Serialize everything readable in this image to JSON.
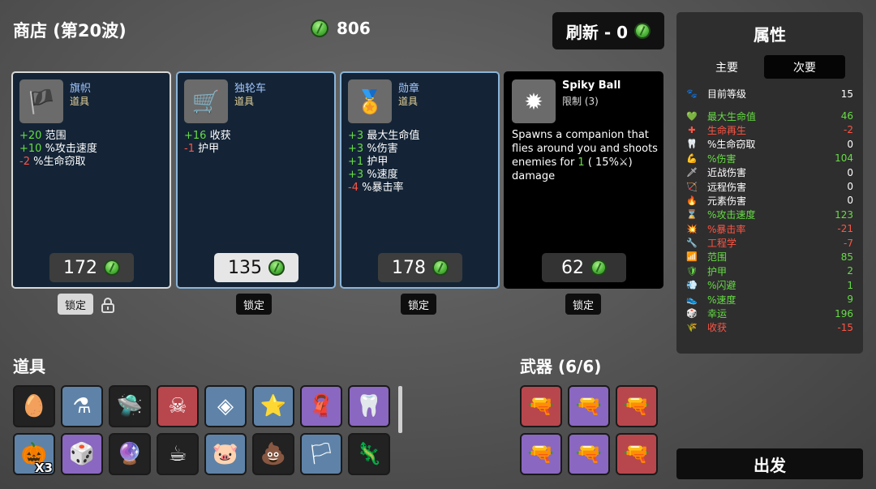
{
  "header": {
    "title": "商店 (第20波)",
    "gold": "806",
    "refresh_label": "刷新 - 0"
  },
  "shop": [
    {
      "name": "旗帜",
      "type": "道具",
      "icon": "flag-icon",
      "glyph": "🏴",
      "stats": [
        {
          "v": "+20",
          "t": "范围",
          "c": "pos"
        },
        {
          "v": "+10",
          "t": "%攻击速度",
          "c": "pos"
        },
        {
          "v": "-2",
          "t": "%生命窃取",
          "c": "neg"
        }
      ],
      "price": "172",
      "lock": "锁定"
    },
    {
      "name": "独轮车",
      "type": "道具",
      "icon": "wheelbarrow-icon",
      "glyph": "🛒",
      "stats": [
        {
          "v": "+16",
          "t": "收获",
          "c": "pos"
        },
        {
          "v": "-1",
          "t": "护甲",
          "c": "neg"
        }
      ],
      "price": "135",
      "lock": "锁定"
    },
    {
      "name": "勋章",
      "type": "道具",
      "icon": "medal-icon",
      "glyph": "🏅",
      "stats": [
        {
          "v": "+3",
          "t": "最大生命值",
          "c": "pos"
        },
        {
          "v": "+3",
          "t": "%伤害",
          "c": "pos"
        },
        {
          "v": "+1",
          "t": "护甲",
          "c": "pos"
        },
        {
          "v": "+3",
          "t": "%速度",
          "c": "pos"
        },
        {
          "v": "-4",
          "t": "%暴击率",
          "c": "neg"
        }
      ],
      "price": "178",
      "lock": "锁定"
    },
    {
      "name": "Spiky Ball",
      "type": "限制 (3)",
      "icon": "spiky-ball-icon",
      "glyph": "✹",
      "desc_a": "Spawns a companion that flies around you and shoots enemies for ",
      "desc_hl": "1",
      "desc_b": " ( 15%⚔) damage",
      "price": "62",
      "lock": "锁定"
    }
  ],
  "stats_panel": {
    "title": "属性",
    "tab_main": "主要",
    "tab_sub": "次要",
    "level": {
      "label": "目前等级",
      "value": "15",
      "icon": "🐾"
    },
    "rows": [
      {
        "label": "最大生命值",
        "value": "46",
        "color": "#66dd44",
        "icon": "💚"
      },
      {
        "label": "生命再生",
        "value": "-2",
        "color": "#ff5544",
        "icon": "✚"
      },
      {
        "label": "%生命窃取",
        "value": "0",
        "color": "#ffffff",
        "icon": "🦷"
      },
      {
        "label": "%伤害",
        "value": "104",
        "color": "#66dd44",
        "icon": "💪"
      },
      {
        "label": "近战伤害",
        "value": "0",
        "color": "#ffffff",
        "icon": "🗡"
      },
      {
        "label": "远程伤害",
        "value": "0",
        "color": "#ffffff",
        "icon": "🏹"
      },
      {
        "label": "元素伤害",
        "value": "0",
        "color": "#ffffff",
        "icon": "🔥"
      },
      {
        "label": "%攻击速度",
        "value": "123",
        "color": "#66dd44",
        "icon": "⌛"
      },
      {
        "label": "%暴击率",
        "value": "-21",
        "color": "#ff5544",
        "icon": "💥"
      },
      {
        "label": "工程学",
        "value": "-7",
        "color": "#ff5544",
        "icon": "🔧"
      },
      {
        "label": "范围",
        "value": "85",
        "color": "#66dd44",
        "icon": "📶"
      },
      {
        "label": "护甲",
        "value": "2",
        "color": "#66dd44",
        "icon": "🛡"
      },
      {
        "label": "%闪避",
        "value": "1",
        "color": "#66dd44",
        "icon": "💨"
      },
      {
        "label": "%速度",
        "value": "9",
        "color": "#66dd44",
        "icon": "👟"
      },
      {
        "label": "幸运",
        "value": "196",
        "color": "#66dd44",
        "icon": "🎲"
      },
      {
        "label": "收获",
        "value": "-15",
        "color": "#ff5544",
        "icon": "🌾"
      }
    ]
  },
  "items_title": "道具",
  "weapons_title": "武器 (6/6)",
  "items": [
    {
      "name": "egg-icon",
      "glyph": "🥚",
      "bg": "c0"
    },
    {
      "name": "potion-icon",
      "glyph": "⚗",
      "bg": "c1"
    },
    {
      "name": "ufo-icon",
      "glyph": "🛸",
      "bg": "c0"
    },
    {
      "name": "pirate-icon",
      "glyph": "☠",
      "bg": "c2"
    },
    {
      "name": "compass-icon",
      "glyph": "◈",
      "bg": "c1"
    },
    {
      "name": "star-icon",
      "glyph": "⭐",
      "bg": "c1"
    },
    {
      "name": "scarf-icon",
      "glyph": "🧣",
      "bg": "c3"
    },
    {
      "name": "tooth-icon",
      "glyph": "🦷",
      "bg": "c3"
    },
    {
      "name": "pumpkin-icon",
      "glyph": "🎃",
      "bg": "c1",
      "count": "X3"
    },
    {
      "name": "dice-icon",
      "glyph": "🎲",
      "bg": "c3"
    },
    {
      "name": "lens-icon",
      "glyph": "🔮",
      "bg": "c0"
    },
    {
      "name": "coffee-icon",
      "glyph": "☕",
      "bg": "c0"
    },
    {
      "name": "piggy-bank-icon",
      "glyph": "🐷",
      "bg": "c1"
    },
    {
      "name": "fertilizer-icon",
      "glyph": "💩",
      "bg": "c0"
    },
    {
      "name": "white-flag-icon",
      "glyph": "🏳",
      "bg": "c1"
    },
    {
      "name": "lizard-icon",
      "glyph": "🦎",
      "bg": "c0"
    }
  ],
  "weapons": [
    {
      "name": "pistol-icon",
      "glyph": "🔫",
      "bg": "c2"
    },
    {
      "name": "pistol-icon",
      "glyph": "🔫",
      "bg": "c3"
    },
    {
      "name": "pistol-icon",
      "glyph": "🔫",
      "bg": "c2"
    },
    {
      "name": "pistol-icon",
      "glyph": "🔫",
      "bg": "c3"
    },
    {
      "name": "pistol-icon",
      "glyph": "🔫",
      "bg": "c3"
    },
    {
      "name": "pistol-icon",
      "glyph": "🔫",
      "bg": "c2"
    }
  ],
  "go_label": "出发"
}
